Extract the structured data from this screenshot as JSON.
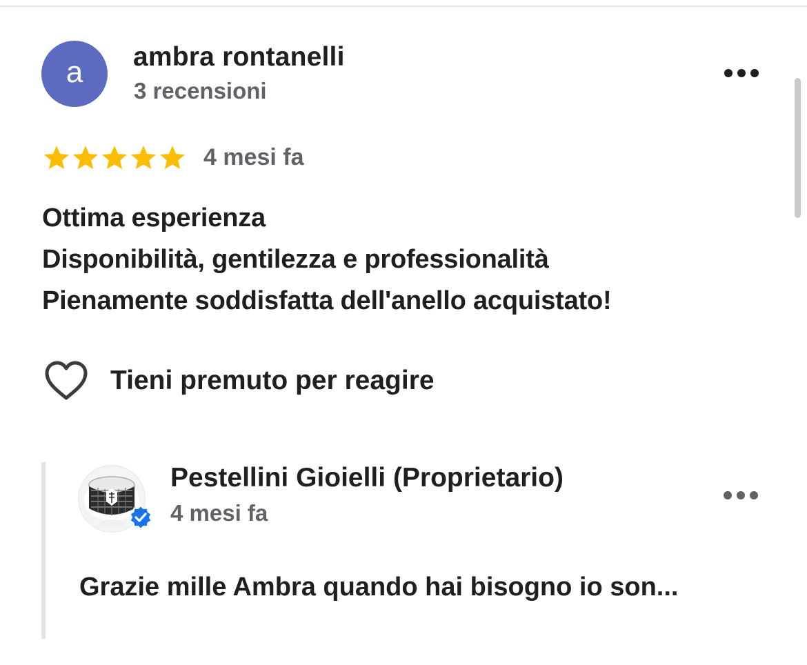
{
  "review": {
    "avatar_letter": "a",
    "avatar_color": "#5c6bc0",
    "author_name": "ambra rontanelli",
    "author_reviews": "3 recensioni",
    "rating": 5,
    "rating_max": 5,
    "star_color": "#fbbc04",
    "time": "4 mesi fa",
    "text_lines": [
      "Ottima esperienza",
      "Disponibilità, gentilezza e professionalità",
      "Pienamente soddisfatta dell'anello acquistato!"
    ],
    "react_label": "Tieni premuto per reagire"
  },
  "reply": {
    "owner_name": "Pestellini Gioielli (Proprietario)",
    "time": "4 mesi fa",
    "text": "Grazie mille Ambra quando hai bisogno io son...",
    "verified_color": "#1a73e8"
  },
  "icons": {
    "more": "more-horizontal-icon",
    "heart": "heart-outline-icon",
    "star": "star-icon",
    "verified": "verified-badge-icon"
  }
}
